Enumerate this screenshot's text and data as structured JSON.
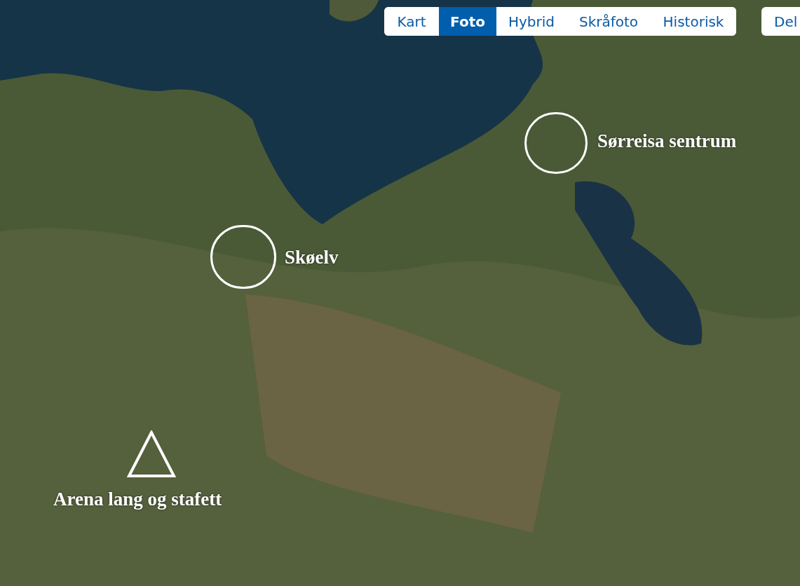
{
  "tabs": [
    {
      "label": "Kart",
      "selected": false
    },
    {
      "label": "Foto",
      "selected": true
    },
    {
      "label": "Hybrid",
      "selected": false
    },
    {
      "label": "Skråfoto",
      "selected": false
    },
    {
      "label": "Historisk",
      "selected": false
    }
  ],
  "share_button": {
    "label": "Del"
  },
  "markers": [
    {
      "kind": "circle",
      "label": "Sørreisa sentrum"
    },
    {
      "kind": "circle",
      "label": "Skøelv"
    },
    {
      "kind": "triangle",
      "label": "Arena lang og stafett"
    }
  ]
}
